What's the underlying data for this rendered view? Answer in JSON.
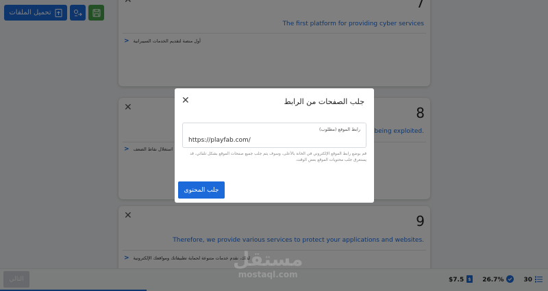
{
  "toolbar": {
    "upload_label": "تحميل الملفات",
    "upload_icon": "file-upload-icon",
    "transfer_icon": "link-transfer-icon",
    "save_icon": "save-icon"
  },
  "cards": [
    {
      "number": "7",
      "english": "The first platform for providing cyber services",
      "arabic": "أول منصة لتقديم الخدمات السيبرانية"
    },
    {
      "number": "8",
      "english": "re being exploited.",
      "arabic": "استغلال نقاط الضعف"
    },
    {
      "number": "9",
      "english": "Therefore, we provide various services to protect your applications and websites.",
      "arabic": "لذلك، نقدم خدمات متنوعة لحماية تطبيقاتك ومواقعك الإلكترونية"
    }
  ],
  "modal": {
    "title": "جلب الصفحات من الرابط",
    "field_label": "رابط الموقع (مطلوب)",
    "field_value": "https://playfab.com/",
    "help_text": "قم بوضع رابط الموقع الإلكتروني في الخانة بالأعلى، وسوف يتم جلب جميع صفحات الموقع بشكل تلقائي، قد يستغرق جلب محتويات الموقع بعض الوقت.",
    "submit_label": "جلب المحتوى"
  },
  "bottom": {
    "prev_label": "التالي",
    "price": "$7.5",
    "percent": "26.7%",
    "count": "30",
    "progress": 0.267
  },
  "watermark": {
    "main": "مستقل",
    "sub": "mostaql.com"
  },
  "colors": {
    "primary": "#1c6ad9",
    "success": "#46a24a"
  }
}
